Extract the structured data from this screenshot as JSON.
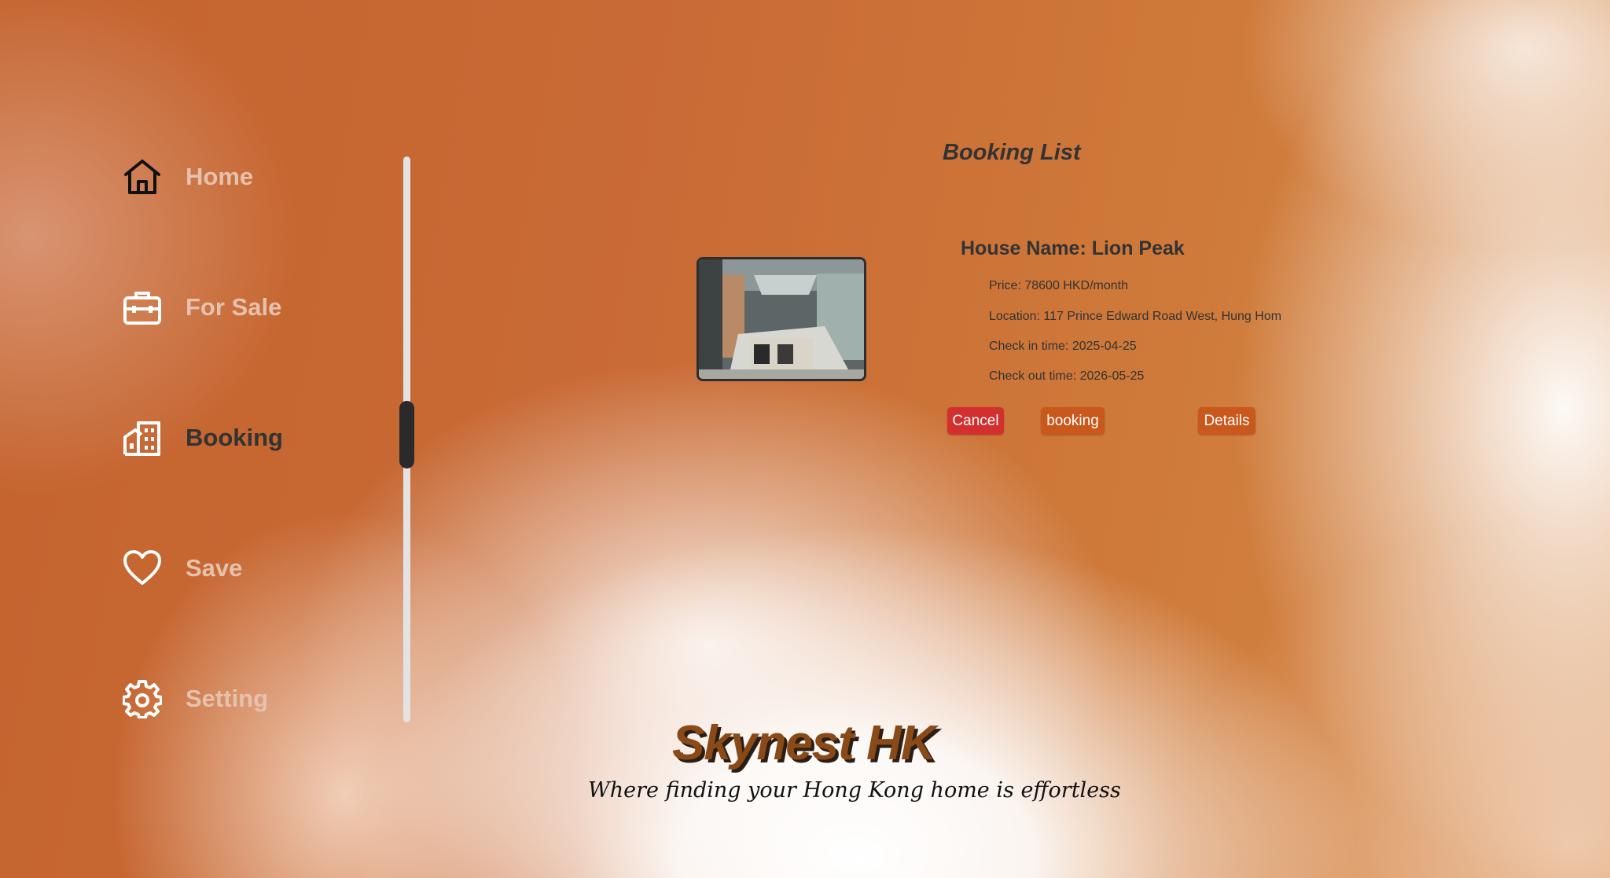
{
  "nav": {
    "items": [
      {
        "label": "Home",
        "icon": "home-icon"
      },
      {
        "label": "For Sale",
        "icon": "briefcase-icon"
      },
      {
        "label": "Booking",
        "icon": "building-icon",
        "active": true
      },
      {
        "label": "Save",
        "icon": "heart-icon"
      },
      {
        "label": "Setting",
        "icon": "gear-icon"
      }
    ]
  },
  "booking": {
    "title": "Booking List",
    "house_name": "House Name: Lion Peak",
    "price": "Price: 78600 HKD/month",
    "location": "Location: 117 Prince Edward Road West, Hung Hom",
    "check_in": "Check in time: 2025-04-25",
    "check_out": "Check out time: 2026-05-25",
    "buttons": {
      "cancel": "Cancel",
      "booking": "booking",
      "details": "Details"
    }
  },
  "brand": {
    "name": "Skynest HK",
    "tagline": "Where finding your Hong Kong home is effortless"
  },
  "colors": {
    "accent": "#c8581b",
    "danger": "#d32f2f",
    "nav_inactive": "#e6c2ad",
    "nav_active": "#333333"
  }
}
